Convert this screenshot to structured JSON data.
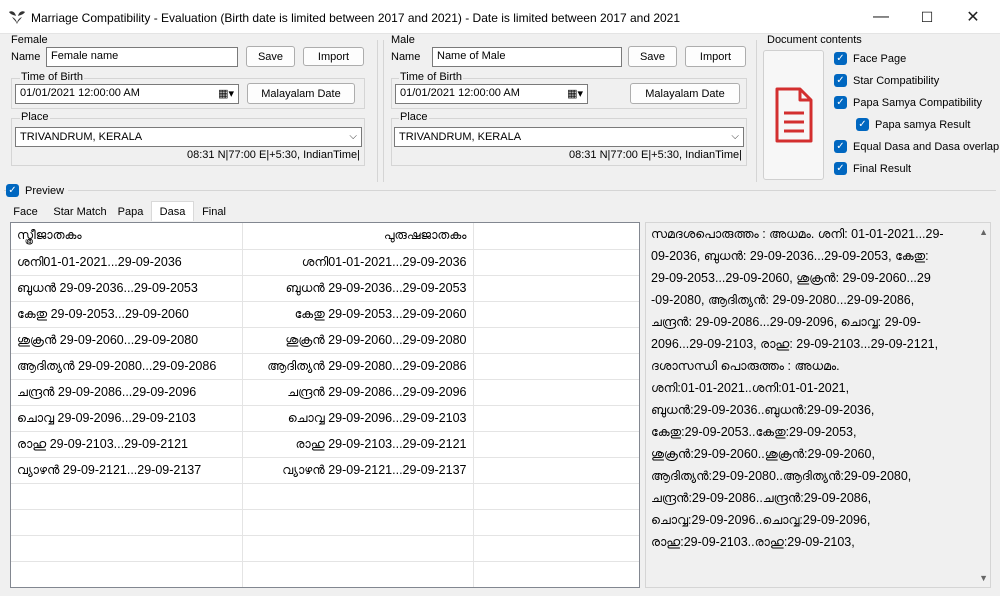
{
  "window": {
    "title": "Marriage  Compatibility - Evaluation  (Birth date is limited between 2017 and 2021)  - Date is limited between 2017 and 2021",
    "minimize": "—",
    "maximize": "☐",
    "close": "✕"
  },
  "female": {
    "group": "Female",
    "name_label": "Name",
    "name_value": "Female name",
    "save": "Save",
    "import": "Import",
    "tob_label": "Time of Birth",
    "tob_value": "01/01/2021  12:00:00 AM",
    "malayalam_date": "Malayalam Date",
    "place_label": "Place",
    "place_value": "TRIVANDRUM, KERALA",
    "coords": "08:31 N|77:00 E|+5:30, IndianTime|"
  },
  "male": {
    "group": "Male",
    "name_label": "Name",
    "name_value": "Name of Male",
    "save": "Save",
    "import": "Import",
    "tob_label": "Time of Birth",
    "tob_value": "01/01/2021  12:00:00 AM",
    "malayalam_date": "Malayalam Date",
    "place_label": "Place",
    "place_value": "TRIVANDRUM, KERALA",
    "coords": "08:31 N|77:00 E|+5:30, IndianTime|"
  },
  "doc_contents": {
    "group": "Document contents",
    "items": [
      {
        "label": "Face Page",
        "checked": true
      },
      {
        "label": "Star Compatibility",
        "checked": true
      },
      {
        "label": "Papa Samya Compatibility",
        "checked": true
      },
      {
        "label": "Papa samya Result",
        "checked": true
      },
      {
        "label": "Equal Dasa and Dasa overlap",
        "checked": true
      },
      {
        "label": "Final Result",
        "checked": true
      }
    ],
    "icon_color": "#d32f2f"
  },
  "preview": {
    "label": "Preview",
    "checked": true
  },
  "tabs": [
    {
      "label": "Face",
      "active": false
    },
    {
      "label": "Star Match",
      "active": false
    },
    {
      "label": "Papa",
      "active": false
    },
    {
      "label": "Dasa",
      "active": true
    },
    {
      "label": "Final",
      "active": false
    }
  ],
  "dasa_table": {
    "headers": [
      "സ്ത്രീജാതകം",
      "പുരുഷജാതകം"
    ],
    "rows": [
      [
        "ശനി01-01-2021...29-09-2036",
        "ശനി01-01-2021...29-09-2036"
      ],
      [
        "ബുധൻ 29-09-2036...29-09-2053",
        "ബുധൻ 29-09-2036...29-09-2053"
      ],
      [
        "കേതു 29-09-2053...29-09-2060",
        "കേതു 29-09-2053...29-09-2060"
      ],
      [
        "ശുക്രൻ 29-09-2060...29-09-2080",
        "ശുക്രൻ 29-09-2060...29-09-2080"
      ],
      [
        "ആദിത്യൻ 29-09-2080...29-09-2086",
        "ആദിത്യൻ 29-09-2080...29-09-2086"
      ],
      [
        "ചന്ദ്രൻ 29-09-2086...29-09-2096",
        "ചന്ദ്രൻ 29-09-2086...29-09-2096"
      ],
      [
        "ചൊവ്വ 29-09-2096...29-09-2103",
        "ചൊവ്വ 29-09-2096...29-09-2103"
      ],
      [
        "രാഹു 29-09-2103...29-09-2121",
        "രാഹു 29-09-2103...29-09-2121"
      ],
      [
        "വ്യാഴൻ 29-09-2121...29-09-2137",
        "വ്യാഴൻ 29-09-2121...29-09-2137"
      ]
    ],
    "empty_rows": 5
  },
  "report_lines": [
    "സമദശപൊരുത്തം : അധമം. ശനി: 01-01-2021...29-",
    "09-2036, ബുധൻ: 29-09-2036...29-09-2053, കേതു:",
    "29-09-2053...29-09-2060, ശുക്രൻ: 29-09-2060...29",
    "-09-2080, ആദിത്യൻ: 29-09-2080...29-09-2086,",
    "ചന്ദ്രൻ: 29-09-2086...29-09-2096, ചൊവ്വ: 29-09-",
    "2096...29-09-2103, രാഹു: 29-09-2103...29-09-2121,",
    "ദശാസന്ധി പൊരുത്തം : അധമം.",
    "ശനി:01-01-2021..ശനി:01-01-2021,",
    "ബുധൻ:29-09-2036..ബുധൻ:29-09-2036,",
    "കേതു:29-09-2053..കേതു:29-09-2053,",
    "ശുക്രൻ:29-09-2060..ശുക്രൻ:29-09-2060,",
    "ആദിത്യൻ:29-09-2080..ആദിത്യൻ:29-09-2080,",
    "ചന്ദ്രൻ:29-09-2086..ചന്ദ്രൻ:29-09-2086,",
    "ചൊവ്വ:29-09-2096..ചൊവ്വ:29-09-2096,",
    "രാഹു:29-09-2103..രാഹു:29-09-2103,"
  ]
}
